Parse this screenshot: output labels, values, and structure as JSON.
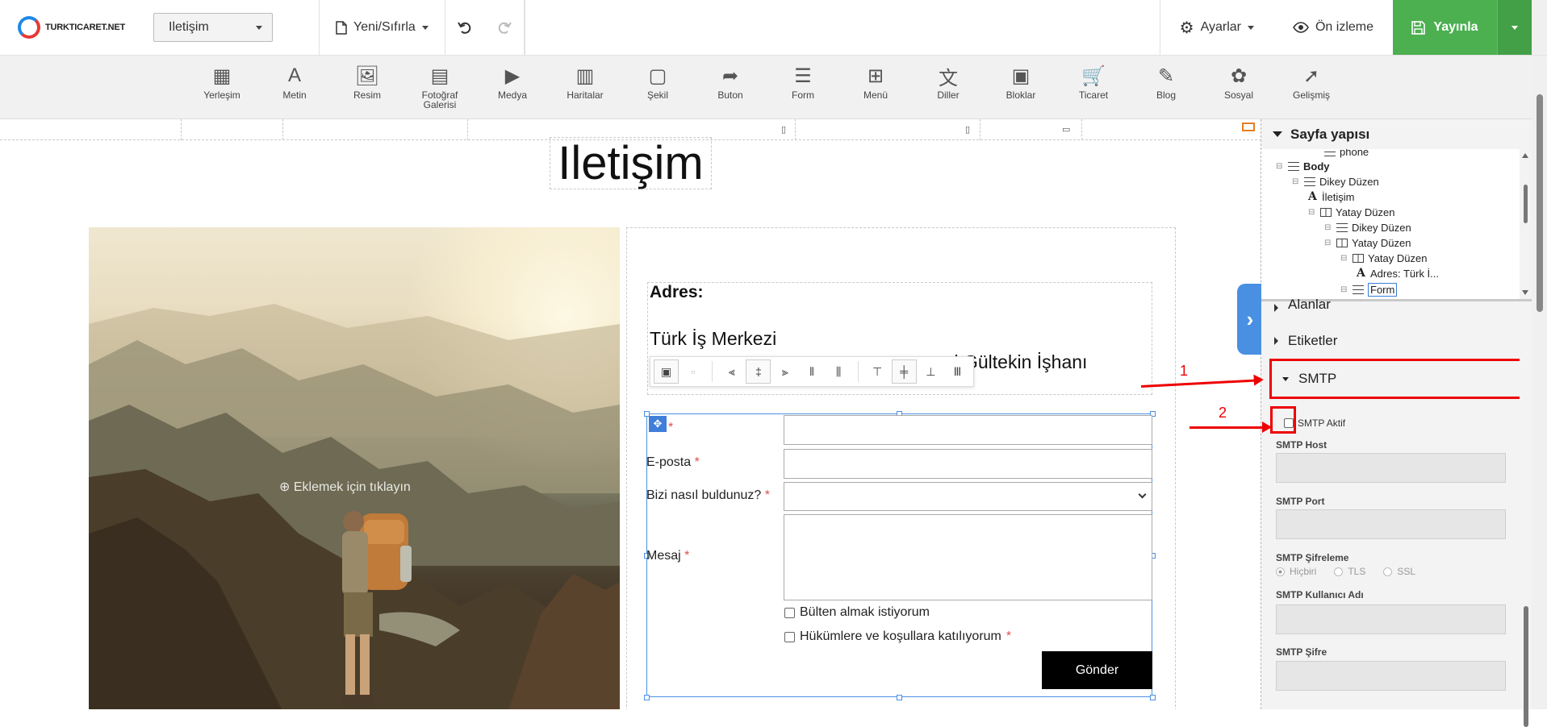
{
  "topbar": {
    "logo_text": "TURKTICARET.NET",
    "page_select": "Iletişim",
    "new_reset": "Yeni/Sıfırla",
    "settings": "Ayarlar",
    "preview": "Ön izleme",
    "publish": "Yayınla"
  },
  "components": [
    {
      "label": "Yerleşim",
      "icon": "layout-icon",
      "glyph": "▦"
    },
    {
      "label": "Metin",
      "icon": "text-icon",
      "glyph": "A"
    },
    {
      "label": "Resim",
      "icon": "image-icon",
      "glyph": "🖼"
    },
    {
      "label": "Fotoğraf Galerisi",
      "icon": "gallery-icon",
      "glyph": "▤"
    },
    {
      "label": "Medya",
      "icon": "media-icon",
      "glyph": "▶"
    },
    {
      "label": "Haritalar",
      "icon": "map-icon",
      "glyph": "▥"
    },
    {
      "label": "Şekil",
      "icon": "shape-icon",
      "glyph": "▢"
    },
    {
      "label": "Buton",
      "icon": "button-icon",
      "glyph": "➦"
    },
    {
      "label": "Form",
      "icon": "form-icon",
      "glyph": "☰"
    },
    {
      "label": "Menü",
      "icon": "menu-icon",
      "glyph": "⊞"
    },
    {
      "label": "Diller",
      "icon": "languages-icon",
      "glyph": "文"
    },
    {
      "label": "Bloklar",
      "icon": "blocks-icon",
      "glyph": "▣"
    },
    {
      "label": "Ticaret",
      "icon": "cart-icon",
      "glyph": "🛒"
    },
    {
      "label": "Blog",
      "icon": "blog-icon",
      "glyph": "✎"
    },
    {
      "label": "Sosyal",
      "icon": "social-icon",
      "glyph": "✿"
    },
    {
      "label": "Gelişmiş",
      "icon": "rocket-icon",
      "glyph": "➚"
    }
  ],
  "canvas": {
    "page_title": "Iletişim",
    "add_hint": "Eklemek için tıklayın",
    "address_title": "Adres:",
    "address_line1": "Türk İş Merkezi",
    "address_line2": "si Gültekin İşhanı",
    "form": {
      "name_label": "A",
      "email_label": "E-posta",
      "how_label": "Bizi nasıl buldunuz?",
      "message_label": "Mesaj",
      "required_mark": "*",
      "newsletter": "Bülten almak istiyorum",
      "terms": "Hükümlere ve koşullara katılıyorum",
      "submit": "Gönder"
    }
  },
  "panel": {
    "structure_title": "Sayfa yapısı",
    "tree": [
      {
        "label": "phone",
        "icon": "h",
        "indent": 3
      },
      {
        "label": "Body",
        "icon": "h",
        "indent": 0,
        "bold": true
      },
      {
        "label": "Dikey Düzen",
        "icon": "h",
        "indent": 1
      },
      {
        "label": "İletişim",
        "icon": "a",
        "indent": 2
      },
      {
        "label": "Yatay Düzen",
        "icon": "v",
        "indent": 2
      },
      {
        "label": "Dikey Düzen",
        "icon": "h",
        "indent": 3
      },
      {
        "label": "Yatay Düzen",
        "icon": "v",
        "indent": 3
      },
      {
        "label": "Yatay Düzen",
        "icon": "v",
        "indent": 4
      },
      {
        "label": "Adres: Türk İ...",
        "icon": "a",
        "indent": 5
      },
      {
        "label": "Form",
        "icon": "h",
        "indent": 4,
        "selected": true
      }
    ],
    "fields_section": "Alanlar",
    "labels_section": "Etiketler",
    "smtp_section": "SMTP",
    "smtp_active": "SMTP Aktif",
    "smtp_host": "SMTP Host",
    "smtp_port": "SMTP Port",
    "smtp_encryption": "SMTP Şifreleme",
    "enc_none": "Hiçbiri",
    "enc_tls": "TLS",
    "enc_ssl": "SSL",
    "smtp_user": "SMTP Kullanıcı Adı",
    "smtp_password": "SMTP Şifre"
  },
  "annotations": {
    "step1": "1",
    "step2": "2"
  },
  "colors": {
    "publish_green": "#4caf50",
    "accent_blue": "#4a90e2",
    "annotation_red": "#ee0000"
  }
}
